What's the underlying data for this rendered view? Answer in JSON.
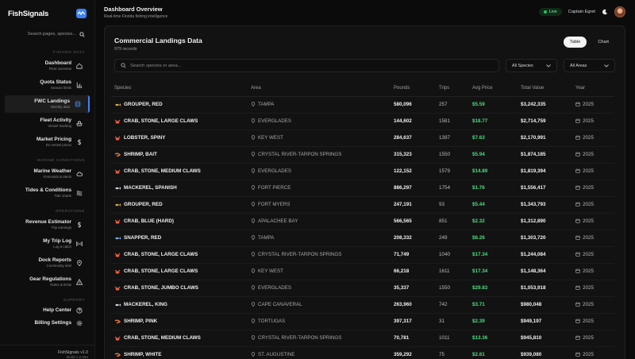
{
  "app": {
    "name": "FishSignals"
  },
  "sidebar": {
    "search_placeholder": "Search pages, species...",
    "sections": [
      {
        "title": "FISHING DATA",
        "items": [
          {
            "label": "Dashboard",
            "sub": "Fleet overview",
            "icon": "home-icon"
          },
          {
            "label": "Quota Status",
            "sub": "Season limits",
            "icon": "bar-chart-icon"
          },
          {
            "label": "FWC Landings",
            "sub": "Weekly data",
            "icon": "database-icon",
            "active": true
          },
          {
            "label": "Fleet Activity",
            "sub": "Vessel tracking",
            "icon": "ship-icon"
          },
          {
            "label": "Market Pricing",
            "sub": "Ex-vessel prices",
            "icon": "dollar-icon"
          }
        ]
      },
      {
        "title": "MARINE CONDITIONS",
        "items": [
          {
            "label": "Marine Weather",
            "sub": "Forecasts & alerts",
            "icon": "cloud-icon"
          },
          {
            "label": "Tides & Conditions",
            "sub": "Tide charts",
            "icon": "waves-icon"
          }
        ]
      },
      {
        "title": "OPERATIONS",
        "items": [
          {
            "label": "Revenue Estimator",
            "sub": "Trip earnings",
            "icon": "dollar-icon"
          },
          {
            "label": "My Trip Log",
            "sub": "Log a catch",
            "icon": "radio-icon"
          },
          {
            "label": "Dock Reports",
            "sub": "Community intel",
            "icon": "map-pin-icon"
          },
          {
            "label": "Gear Regulations",
            "sub": "Rules & limits",
            "icon": "warning-icon"
          }
        ]
      },
      {
        "title": "SUPPORT",
        "items": [
          {
            "label": "Help Center",
            "sub": "",
            "icon": "help-icon"
          },
          {
            "label": "Billing Settings",
            "sub": "",
            "icon": "gear-icon"
          }
        ]
      }
    ],
    "footer_version": "FishSignals v1.0",
    "footer_build": "Build 1.0.34a"
  },
  "header": {
    "title": "Dashboard Overview",
    "subtitle": "Real-time Florida fishing intelligence",
    "live_label": "Live",
    "user_name": "Captain Egret"
  },
  "card": {
    "title": "Commercial Landings Data",
    "records": "979 records",
    "view_table": "Table",
    "view_chart": "Chart",
    "search_placeholder": "Search species or area...",
    "species_filter": "All Species",
    "areas_filter": "All Areas",
    "columns": [
      "Species",
      "Area",
      "Pounds",
      "Trips",
      "Avg Price",
      "Total Value",
      "Year"
    ],
    "rows": [
      {
        "species": "GROUPER, RED",
        "kind": "fish",
        "area": "TAMPA",
        "pounds": "580,096",
        "trips": "257",
        "price": "$5.59",
        "value": "$3,242,335",
        "year": "2025"
      },
      {
        "species": "CRAB, STONE, LARGE CLAWS",
        "kind": "crab",
        "area": "EVERGLADES",
        "pounds": "144,602",
        "trips": "1581",
        "price": "$18.77",
        "value": "$2,714,759",
        "year": "2025"
      },
      {
        "species": "LOBSTER, SPINY",
        "kind": "crab",
        "area": "KEY WEST",
        "pounds": "284,637",
        "trips": "1397",
        "price": "$7.63",
        "value": "$2,170,991",
        "year": "2025"
      },
      {
        "species": "SHRIMP, BAIT",
        "kind": "shrimp",
        "area": "CRYSTAL RIVER-TARPON SPRINGS",
        "pounds": "315,323",
        "trips": "1550",
        "price": "$5.94",
        "value": "$1,874,185",
        "year": "2025"
      },
      {
        "species": "CRAB, STONE, MEDIUM CLAWS",
        "kind": "crab",
        "area": "EVERGLADES",
        "pounds": "122,152",
        "trips": "1579",
        "price": "$14.89",
        "value": "$1,819,394",
        "year": "2025"
      },
      {
        "species": "MACKEREL, SPANISH",
        "kind": "fish2",
        "area": "FORT PIERCE",
        "pounds": "886,297",
        "trips": "1754",
        "price": "$1.76",
        "value": "$1,556,417",
        "year": "2025"
      },
      {
        "species": "GROUPER, RED",
        "kind": "fish",
        "area": "FORT MYERS",
        "pounds": "247,191",
        "trips": "93",
        "price": "$5.44",
        "value": "$1,343,793",
        "year": "2025"
      },
      {
        "species": "CRAB, BLUE (HARD)",
        "kind": "crab",
        "area": "APALACHEE BAY",
        "pounds": "566,565",
        "trips": "851",
        "price": "$2.32",
        "value": "$1,312,890",
        "year": "2025"
      },
      {
        "species": "SNAPPER, RED",
        "kind": "fish3",
        "area": "TAMPA",
        "pounds": "208,332",
        "trips": "249",
        "price": "$6.26",
        "value": "$1,303,720",
        "year": "2025"
      },
      {
        "species": "CRAB, STONE, LARGE CLAWS",
        "kind": "crab",
        "area": "CRYSTAL RIVER-TARPON SPRINGS",
        "pounds": "71,749",
        "trips": "1040",
        "price": "$17.34",
        "value": "$1,244,084",
        "year": "2025"
      },
      {
        "species": "CRAB, STONE, LARGE CLAWS",
        "kind": "crab",
        "area": "KEY WEST",
        "pounds": "66,218",
        "trips": "1611",
        "price": "$17.34",
        "value": "$1,148,364",
        "year": "2025"
      },
      {
        "species": "CRAB, STONE, JUMBO CLAWS",
        "kind": "crab",
        "area": "EVERGLADES",
        "pounds": "35,337",
        "trips": "1550",
        "price": "$29.83",
        "value": "$1,053,918",
        "year": "2025"
      },
      {
        "species": "MACKEREL, KING",
        "kind": "fish2",
        "area": "CAPE CANAVERAL",
        "pounds": "263,960",
        "trips": "742",
        "price": "$3.71",
        "value": "$980,048",
        "year": "2025"
      },
      {
        "species": "SHRIMP, PINK",
        "kind": "shrimp",
        "area": "TORTUGAS",
        "pounds": "397,317",
        "trips": "31",
        "price": "$2.39",
        "value": "$949,197",
        "year": "2025"
      },
      {
        "species": "CRAB, STONE, MEDIUM CLAWS",
        "kind": "crab",
        "area": "CRYSTAL RIVER-TARPON SPRINGS",
        "pounds": "70,781",
        "trips": "1011",
        "price": "$13.36",
        "value": "$945,810",
        "year": "2025"
      },
      {
        "species": "SHRIMP, WHITE",
        "kind": "shrimp",
        "area": "ST. AUGUSTINE",
        "pounds": "359,292",
        "trips": "75",
        "price": "$2.61",
        "value": "$939,080",
        "year": "2025"
      }
    ]
  },
  "colors": {
    "accent": "#3b82f6",
    "price_green": "#4ade80",
    "crab": "#ef5a3c",
    "fish": "#e0b44a",
    "shrimp": "#f07a3a",
    "fish2": "#cfd8e3",
    "fish3": "#7fb3ff"
  }
}
